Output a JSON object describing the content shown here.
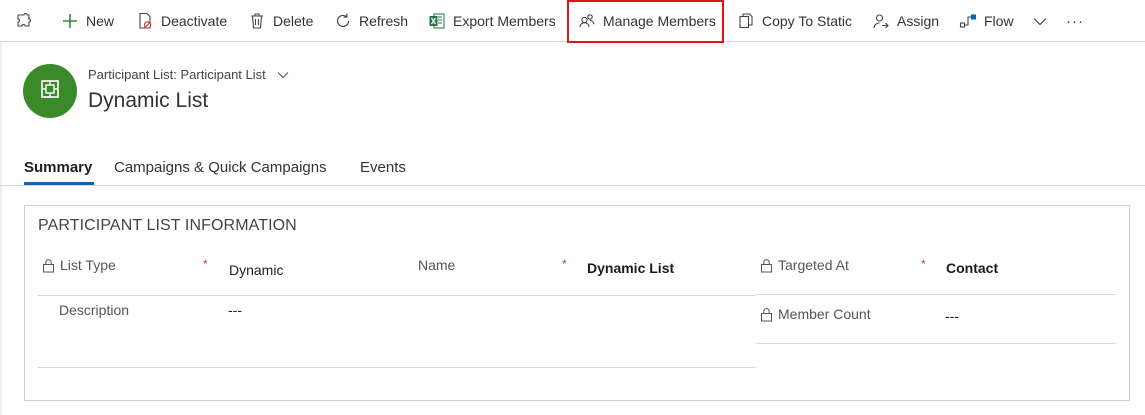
{
  "commandbar": {
    "items": [
      {
        "label": "New",
        "icon": "plus-icon"
      },
      {
        "label": "Deactivate",
        "icon": "deactivate-icon"
      },
      {
        "label": "Delete",
        "icon": "trash-icon"
      },
      {
        "label": "Refresh",
        "icon": "refresh-icon"
      },
      {
        "label": "Export Members",
        "icon": "excel-icon"
      },
      {
        "label": "Manage Members",
        "icon": "people-icon"
      },
      {
        "label": "Copy To Static",
        "icon": "copy-icon"
      },
      {
        "label": "Assign",
        "icon": "assign-icon"
      },
      {
        "label": "Flow",
        "icon": "flow-icon"
      },
      {
        "label": "···",
        "icon": "more-icon"
      }
    ],
    "highlight_color": "#e0121b"
  },
  "header": {
    "entity_label": "Participant List: Participant List",
    "title": "Dynamic List",
    "avatar_color": "#3b8a2a"
  },
  "tabs": [
    {
      "label": "Summary",
      "active": true
    },
    {
      "label": "Campaigns & Quick Campaigns",
      "active": false
    },
    {
      "label": "Events",
      "active": false
    }
  ],
  "section": {
    "title": "PARTICIPANT LIST INFORMATION",
    "fields": {
      "list_type": {
        "label": "List Type",
        "required_mark": "*",
        "value": "Dynamic"
      },
      "name": {
        "label": "Name",
        "required_mark": "*",
        "value": "Dynamic List"
      },
      "targeted_at": {
        "label": "Targeted At",
        "required_mark": "*",
        "value": "Contact"
      },
      "description": {
        "label": "Description",
        "value": "---"
      },
      "member_count": {
        "label": "Member Count",
        "value": "---"
      }
    }
  },
  "colors": {
    "accent": "#1160b7",
    "required": "#d13438"
  }
}
